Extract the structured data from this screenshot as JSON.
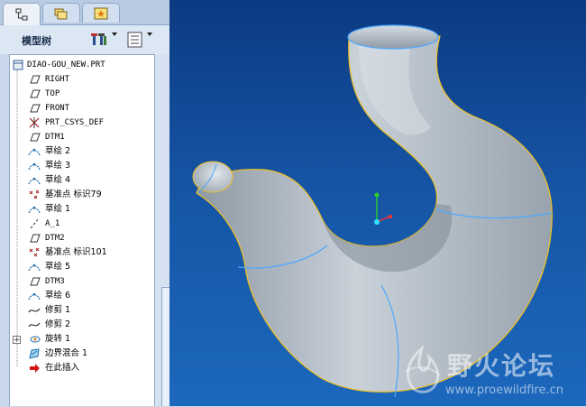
{
  "panel": {
    "tree_title": "模型树",
    "tabs": [
      {
        "name": "model-tree-tab",
        "active": true
      },
      {
        "name": "folder-browser-tab",
        "active": false
      },
      {
        "name": "favorites-tab",
        "active": false
      }
    ]
  },
  "tree": {
    "root": "DIAO-GOU_NEW.PRT",
    "items": [
      {
        "label": "RIGHT",
        "icon": "datum-plane-icon"
      },
      {
        "label": "TOP",
        "icon": "datum-plane-icon"
      },
      {
        "label": "FRONT",
        "icon": "datum-plane-icon"
      },
      {
        "label": "PRT_CSYS_DEF",
        "icon": "coordinate-system-icon"
      },
      {
        "label": "DTM1",
        "icon": "datum-plane-icon"
      },
      {
        "label": "草绘 2",
        "icon": "sketch-icon"
      },
      {
        "label": "草绘 3",
        "icon": "sketch-icon"
      },
      {
        "label": "草绘 4",
        "icon": "sketch-icon"
      },
      {
        "label": "基准点 标识79",
        "icon": "datum-point-icon"
      },
      {
        "label": "草绘 1",
        "icon": "sketch-icon"
      },
      {
        "label": "A_1",
        "icon": "datum-axis-icon"
      },
      {
        "label": "DTM2",
        "icon": "datum-plane-icon"
      },
      {
        "label": "基准点 标识101",
        "icon": "datum-point-icon"
      },
      {
        "label": "草绘 5",
        "icon": "sketch-icon"
      },
      {
        "label": "DTM3",
        "icon": "datum-plane-icon"
      },
      {
        "label": "草绘 6",
        "icon": "sketch-icon"
      },
      {
        "label": "修剪 1",
        "icon": "trim-curve-icon"
      },
      {
        "label": "修剪 2",
        "icon": "trim-curve-icon"
      },
      {
        "label": "旋转 1",
        "icon": "revolve-icon"
      },
      {
        "label": "边界混合 1",
        "icon": "boundary-blend-icon"
      },
      {
        "label": "在此插入",
        "icon": "insert-here-arrow-icon"
      }
    ]
  },
  "watermark": {
    "title": "野火论坛",
    "url": "www.proewildfire.cn"
  },
  "colors": {
    "viewport_top": "#0c3a82",
    "viewport_bottom": "#1c68bd",
    "part_surface": "#a9b3bd",
    "edge_highlight": "#f0c020",
    "boundary_curve": "#4aa8ff"
  }
}
